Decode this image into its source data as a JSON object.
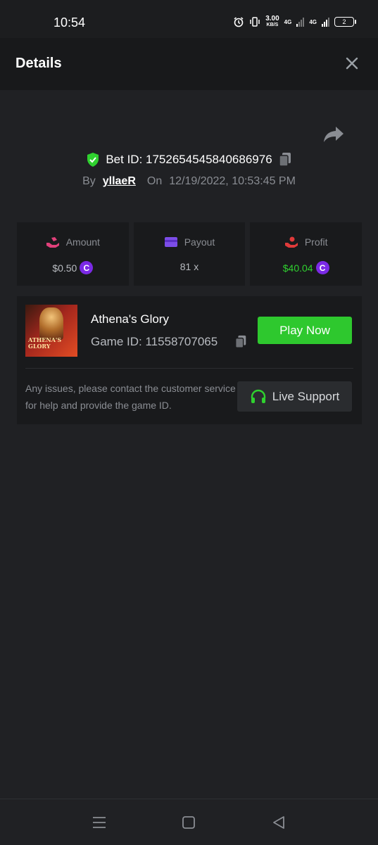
{
  "status": {
    "time": "10:54",
    "speed_value": "3.00",
    "speed_unit": "KB/S",
    "net1": "4G",
    "net2": "4G",
    "battery": "2"
  },
  "header": {
    "title": "Details"
  },
  "bet": {
    "id_label": "Bet ID: 1752654545840686976",
    "by_label": "By",
    "username": "yllaeR",
    "on_label": "On",
    "datetime": "12/19/2022, 10:53:45 PM"
  },
  "stats": [
    {
      "label": "Amount",
      "value": "$0.50",
      "icon": "hand-coins-icon",
      "color": "#e0407a"
    },
    {
      "label": "Payout",
      "value": "81 x",
      "icon": "wallet-card-icon",
      "color": "#7c4de8"
    },
    {
      "label": "Profit",
      "value": "$40.04",
      "icon": "profit-hand-icon",
      "color": "#e03a3a"
    }
  ],
  "coin_symbol": "C",
  "game": {
    "name": "Athena's Glory",
    "id_label": "Game ID: 11558707065",
    "thumb_text": "ATHENA'S GLORY",
    "play_label": "Play Now",
    "support_text": "Any issues, please contact the customer service for help and provide the game ID.",
    "live_support_label": "Live Support"
  },
  "colors": {
    "accent_green": "#2ec82e",
    "coin_purple": "#7b2ae6",
    "shield_green": "#2fd12f"
  }
}
